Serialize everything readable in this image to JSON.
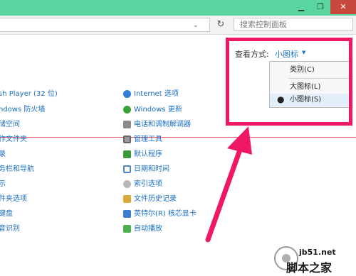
{
  "window": {
    "minimize_glyph": "▁",
    "maximize_glyph": "❐",
    "close_glyph": "✕"
  },
  "addressbar": {
    "refresh_glyph": "↻",
    "dropdown_glyph": "⌄",
    "search_placeholder": "搜索控制面板"
  },
  "view": {
    "label": "查看方式:",
    "value": "小图标",
    "arrow": "▼"
  },
  "view_menu": {
    "items": [
      "类别(C)",
      "大图标(L)",
      "小图标(S)"
    ],
    "selected_index": 2,
    "bullet": "●"
  },
  "left_items": [
    "sh Player (32 位)",
    "ndows 防火墙",
    "储空间",
    "作文件夹",
    "录",
    "务栏和导航",
    "示",
    "件夹选项",
    "键盘",
    "音识别"
  ],
  "right_items": [
    "Internet 选项",
    "Windows 更新",
    "电话和调制解调器",
    "管理工具",
    "默认程序",
    "日期和时间",
    "索引选项",
    "文件历史记录",
    "英特尔(R) 核芯显卡",
    "自动播放"
  ],
  "watermark": {
    "line1": "jb51.net",
    "line2": "脚本之家"
  },
  "colors": {
    "titlebar": "#5ad5a2",
    "highlight": "#ef1866",
    "link": "#1a6fc4"
  }
}
